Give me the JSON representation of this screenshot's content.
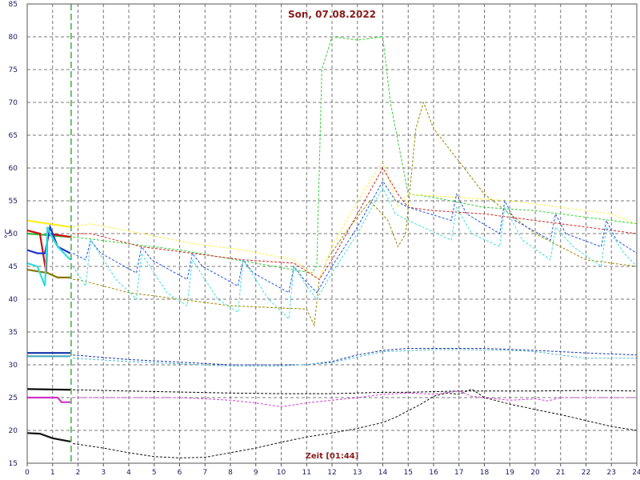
{
  "chart_data": {
    "type": "line",
    "title": "Son, 07.08.2022",
    "xlabel": "Zeit [01:44]",
    "ylabel": "°C",
    "xlim": [
      0,
      24
    ],
    "ylim": [
      15,
      85
    ],
    "xticks": [
      0,
      1,
      2,
      3,
      4,
      5,
      6,
      7,
      8,
      9,
      10,
      11,
      12,
      13,
      14,
      15,
      16,
      17,
      18,
      19,
      20,
      21,
      22,
      23,
      24
    ],
    "yticks": [
      15,
      20,
      25,
      30,
      35,
      40,
      45,
      50,
      55,
      60,
      65,
      70,
      75,
      80,
      85
    ],
    "grid": true,
    "current_time_marker": 1.73,
    "series": [
      {
        "color": "#33cc33",
        "style": "dashed",
        "x": [
          1.8,
          6,
          11.2,
          11.4,
          11.6,
          12,
          13,
          14,
          14.3,
          15,
          15.5,
          16,
          18,
          20,
          22,
          24
        ],
        "y": [
          49.5,
          47.5,
          44,
          45,
          75,
          80,
          79.5,
          80,
          70,
          56,
          55.8,
          55.5,
          54,
          53.5,
          52.5,
          51.5
        ]
      },
      {
        "color": "#998800",
        "style": "dashed",
        "x": [
          1.8,
          2,
          4,
          8,
          11,
          11.3,
          11.5,
          11.8,
          12.5,
          13.5,
          14.2,
          14.6,
          14.9,
          15.3,
          15.6,
          16,
          18,
          20,
          22,
          24
        ],
        "y": [
          43,
          43,
          41,
          39,
          38.5,
          36,
          43,
          46,
          50,
          55,
          52,
          48,
          50,
          66,
          70,
          66,
          56,
          50,
          46,
          45
        ]
      },
      {
        "color": "#ffee44",
        "style": "dashed",
        "x": [
          1.8,
          2.5,
          4.5,
          6.5,
          8.5,
          10.5,
          11.5,
          12,
          13,
          14,
          14.6,
          15,
          17,
          19,
          21,
          23,
          24
        ],
        "y": [
          51,
          51.5,
          50,
          48.5,
          47.5,
          46,
          43,
          48,
          55,
          61,
          54,
          56,
          55.5,
          55,
          54,
          53,
          51.5
        ]
      },
      {
        "color": "#cc2222",
        "style": "dashed",
        "x": [
          1.8,
          2.5,
          4.5,
          6.5,
          8.5,
          10.5,
          11.5,
          12,
          13,
          14,
          14.6,
          15,
          16,
          18,
          20,
          22,
          24
        ],
        "y": [
          50,
          50,
          48,
          47,
          46,
          45.5,
          43,
          46,
          53,
          60,
          56,
          54,
          53.5,
          53,
          52,
          51,
          50
        ]
      },
      {
        "color": "#2255dd",
        "style": "dashed",
        "x": [
          1.8,
          2.3,
          2.5,
          2.9,
          4.3,
          4.5,
          4.9,
          6.3,
          6.5,
          6.9,
          8.3,
          8.5,
          8.9,
          10.3,
          10.5,
          10.9,
          11.4,
          12,
          13,
          14,
          14.5,
          15,
          16.7,
          16.9,
          17.3,
          18.6,
          18.8,
          19.2,
          20.6,
          20.8,
          21.2,
          22.6,
          22.8,
          23.2,
          24
        ],
        "y": [
          47,
          46,
          49,
          47,
          44,
          48,
          46,
          43,
          47,
          45,
          42,
          46,
          44,
          41,
          45,
          43,
          41,
          45,
          51,
          58,
          55,
          54,
          52,
          56,
          53,
          50,
          55,
          52,
          49,
          53,
          50,
          48,
          52,
          49,
          47
        ]
      },
      {
        "color": "#44dddd",
        "style": "dashed",
        "x": [
          1.8,
          2.3,
          2.5,
          3.5,
          4.3,
          4.5,
          5.5,
          6.3,
          6.5,
          7.5,
          8.3,
          8.5,
          9.5,
          10.3,
          10.5,
          11,
          11.4,
          12,
          13,
          14,
          14.5,
          15,
          16.7,
          16.9,
          17.5,
          18.6,
          18.8,
          19.5,
          20.6,
          20.8,
          21.5,
          22.6,
          22.8,
          23.5,
          24
        ],
        "y": [
          45,
          42,
          49,
          43,
          40,
          47,
          41,
          39,
          46,
          40,
          38,
          46,
          40,
          37,
          45,
          42,
          40,
          44,
          50,
          57,
          53,
          52,
          49,
          54,
          50,
          48,
          54,
          49,
          46,
          51,
          48,
          45,
          51,
          47,
          45
        ]
      },
      {
        "color": "#1133aa",
        "style": "dashed",
        "x": [
          1.8,
          4,
          8,
          10,
          11,
          12,
          13,
          14,
          15,
          16,
          17,
          18,
          20,
          21,
          22,
          24
        ],
        "y": [
          31.5,
          30.8,
          30,
          30,
          30,
          30.5,
          31.5,
          32.2,
          32.5,
          32.5,
          32.5,
          32.5,
          32.2,
          32,
          31.8,
          31.5
        ]
      },
      {
        "color": "#55bbcc",
        "style": "dashed",
        "x": [
          1.8,
          4,
          8,
          10,
          12,
          13,
          14,
          16,
          17,
          19,
          20,
          21,
          22,
          24
        ],
        "y": [
          31,
          30.5,
          29.8,
          29.8,
          30.3,
          31.2,
          32,
          32.3,
          32.3,
          32.2,
          32,
          31.5,
          31,
          31
        ]
      },
      {
        "color": "#000000",
        "style": "dashed",
        "x": [
          1.8,
          4,
          8,
          10,
          12,
          14,
          15,
          16,
          17,
          18,
          20,
          22,
          24
        ],
        "y": [
          26.2,
          26,
          25.7,
          25.6,
          25.6,
          25.8,
          25.8,
          25.9,
          26,
          26,
          26,
          26.1,
          26
        ]
      },
      {
        "color": "#cc44cc",
        "style": "dashed",
        "x": [
          1.8,
          4,
          6,
          7,
          8,
          9,
          10,
          11,
          12,
          13,
          14,
          15,
          16,
          17,
          17.5,
          18,
          19,
          20,
          20.5,
          21,
          22,
          24
        ],
        "y": [
          25,
          25,
          25,
          24.8,
          24.6,
          24.2,
          23.6,
          24.2,
          24.6,
          25,
          25.5,
          25.7,
          25.5,
          26,
          25.2,
          25,
          24.6,
          24.8,
          24.5,
          25,
          25,
          25
        ]
      },
      {
        "color": "#111111",
        "style": "dashed",
        "x": [
          1.8,
          3,
          4,
          5,
          6,
          7,
          8,
          9,
          10,
          11,
          12,
          13,
          14,
          14.5,
          15,
          15.5,
          16,
          16.5,
          17,
          17.5,
          18,
          19,
          20,
          21,
          22,
          23,
          24
        ],
        "y": [
          18,
          17.3,
          16.6,
          16,
          15.8,
          15.9,
          16.6,
          17.3,
          18.2,
          19,
          19.6,
          20.3,
          21.2,
          22,
          23,
          24,
          25.2,
          25.7,
          25.5,
          26.3,
          25,
          24,
          23.2,
          22.4,
          21.5,
          20.6,
          20
        ]
      },
      {
        "color": "#ffee22",
        "style": "solid",
        "x": [
          0,
          1.7
        ],
        "y": [
          52,
          51
        ]
      },
      {
        "color": "#33bb33",
        "style": "solid",
        "x": [
          0,
          1.7
        ],
        "y": [
          50,
          49.5
        ]
      },
      {
        "color": "#cc1111",
        "style": "solid",
        "x": [
          0,
          0.5,
          0.75,
          0.8,
          0.85,
          1.7
        ],
        "y": [
          50.5,
          50,
          44,
          51,
          50,
          49.5
        ]
      },
      {
        "color": "#887700",
        "style": "solid",
        "x": [
          0,
          0.8,
          1.2,
          1.7
        ],
        "y": [
          44.5,
          44,
          43.3,
          43.3
        ]
      },
      {
        "color": "#2233cc",
        "style": "solid",
        "x": [
          0,
          0.4,
          0.7,
          0.9,
          1.2,
          1.7
        ],
        "y": [
          47.5,
          47,
          47,
          51,
          48,
          47
        ]
      },
      {
        "color": "#33dddd",
        "style": "solid",
        "x": [
          0,
          0.4,
          0.7,
          0.8,
          0.9,
          1.2,
          1.7
        ],
        "y": [
          45.5,
          45,
          42,
          51,
          50,
          48,
          46
        ]
      },
      {
        "color": "#1133aa",
        "style": "solid",
        "x": [
          0,
          1.7
        ],
        "y": [
          31.8,
          31.8
        ]
      },
      {
        "color": "#44aabb",
        "style": "solid",
        "x": [
          0,
          1.7
        ],
        "y": [
          31.3,
          31.3
        ]
      },
      {
        "color": "#000000",
        "style": "solid",
        "x": [
          0,
          1.7
        ],
        "y": [
          26.3,
          26.2
        ]
      },
      {
        "color": "#cc33cc",
        "style": "solid",
        "x": [
          0,
          1.2,
          1.35,
          1.7
        ],
        "y": [
          25,
          25,
          24.3,
          24.3
        ]
      },
      {
        "color": "#111111",
        "style": "solid",
        "x": [
          0,
          0.5,
          1,
          1.7
        ],
        "y": [
          19.6,
          19.5,
          18.8,
          18.3
        ]
      }
    ]
  }
}
